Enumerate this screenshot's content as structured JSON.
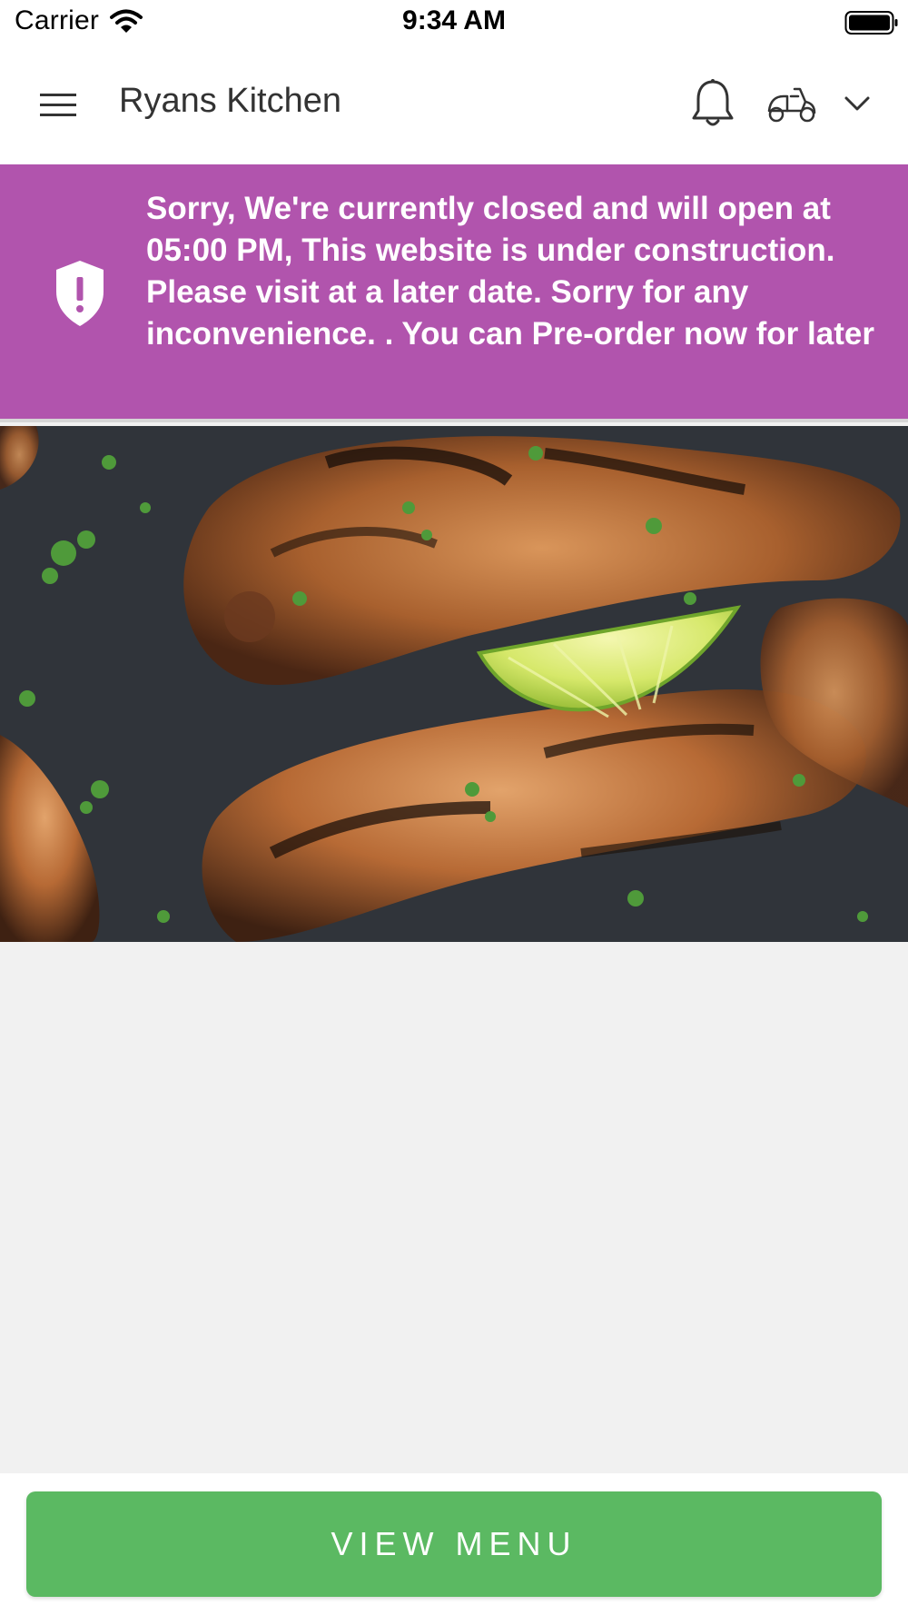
{
  "status_bar": {
    "carrier": "Carrier",
    "time": "9:34 AM",
    "wifi_icon": "wifi-icon",
    "battery_icon": "battery-icon"
  },
  "header": {
    "title": "Ryans Kitchen",
    "menu_icon": "menu-icon",
    "notification_icon": "bell-icon",
    "delivery_icon": "scooter-icon",
    "dropdown_icon": "chevron-down-icon"
  },
  "notice": {
    "icon": "shield-alert-icon",
    "message": "Sorry, We're currently closed and will open at 05:00 PM, This website is under construction. Please visit at a later date. Sorry for any inconvenience. . You can Pre-order now for later"
  },
  "hero": {
    "image": "grilled-chicken-drumsticks-with-lime"
  },
  "footer": {
    "view_menu_label": "VIEW MENU"
  },
  "colors": {
    "banner": "#b154ad",
    "button": "#5bb962",
    "background": "#f1f1f1"
  }
}
